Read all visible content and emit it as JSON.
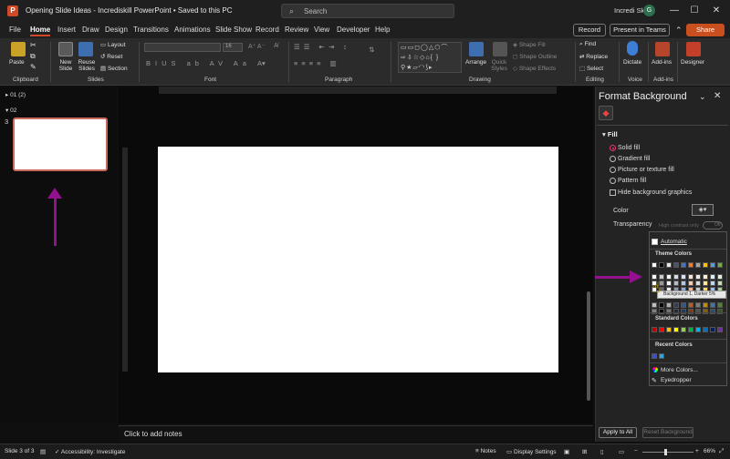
{
  "window": {
    "title": "Opening Slide Ideas - Incrediskill PowerPoint • Saved to this PC",
    "app_logo": "P",
    "search_placeholder": "Search",
    "user_name": "Incredi Skill",
    "user_initial": "G"
  },
  "menu": {
    "tabs": [
      "File",
      "Home",
      "Insert",
      "Draw",
      "Design",
      "Transitions",
      "Animations",
      "Slide Show",
      "Record",
      "Review",
      "View",
      "Developer",
      "Help"
    ],
    "active_tab": "Home",
    "record": "Record",
    "present_teams": "Present in Teams",
    "share": "Share"
  },
  "ribbon": {
    "groups": [
      "Clipboard",
      "Slides",
      "Font",
      "Paragraph",
      "Drawing",
      "Editing",
      "Voice",
      "Add-ins"
    ],
    "paste": "Paste",
    "new_slide": "New Slide",
    "reuse_slides": "Reuse Slides",
    "layout": "Layout",
    "reset": "Reset",
    "section": "Section",
    "font_size": "16",
    "arrange": "Arrange",
    "quick_styles": "Quick Styles",
    "shape_fill": "Shape Fill",
    "shape_outline": "Shape Outline",
    "shape_effects": "Shape Effects",
    "find": "Find",
    "replace": "Replace",
    "select": "Select",
    "dictate": "Dictate",
    "add_ins": "Add-ins",
    "designer": "Designer"
  },
  "slides_panel": {
    "sections": [
      "01 (2)",
      "02"
    ],
    "slide_number": "3"
  },
  "notes_placeholder": "Click to add notes",
  "format_background": {
    "title": "Format Background",
    "fill_header": "Fill",
    "options": [
      "Solid fill",
      "Gradient fill",
      "Picture or texture fill",
      "Pattern fill"
    ],
    "selected_option": "Solid fill",
    "hide_graphics": "Hide background graphics",
    "color_label": "Color",
    "transparency_label": "Transparency",
    "high_contrast": "High contrast only",
    "toggle_state": "Off",
    "apply_all": "Apply to All",
    "reset_background": "Reset Background"
  },
  "color_dropdown": {
    "automatic": "Automatic",
    "theme_colors": "Theme Colors",
    "tooltip": "Background 1, Darker 5%",
    "standard_colors": "Standard Colors",
    "recent_colors": "Recent Colors",
    "more_colors": "More Colors...",
    "eyedropper": "Eyedropper",
    "theme_row": [
      "#ffffff",
      "#000000",
      "#e7e6e6",
      "#44546a",
      "#4472c4",
      "#ed7d31",
      "#a5a5a5",
      "#ffc000",
      "#5b9bd5",
      "#70ad47"
    ],
    "standard_row": [
      "#c00000",
      "#ff0000",
      "#ffc000",
      "#ffff00",
      "#92d050",
      "#00b050",
      "#00b0f0",
      "#0070c0",
      "#002060",
      "#7030a0"
    ],
    "recent_row": [
      "#3a4fd8",
      "#2aa8e0"
    ]
  },
  "status": {
    "slide": "Slide 3 of 3",
    "accessibility": "Accessibility: Investigate",
    "notes": "Notes",
    "display_settings": "Display Settings",
    "zoom": "66%"
  },
  "accent_color": "#93108f"
}
